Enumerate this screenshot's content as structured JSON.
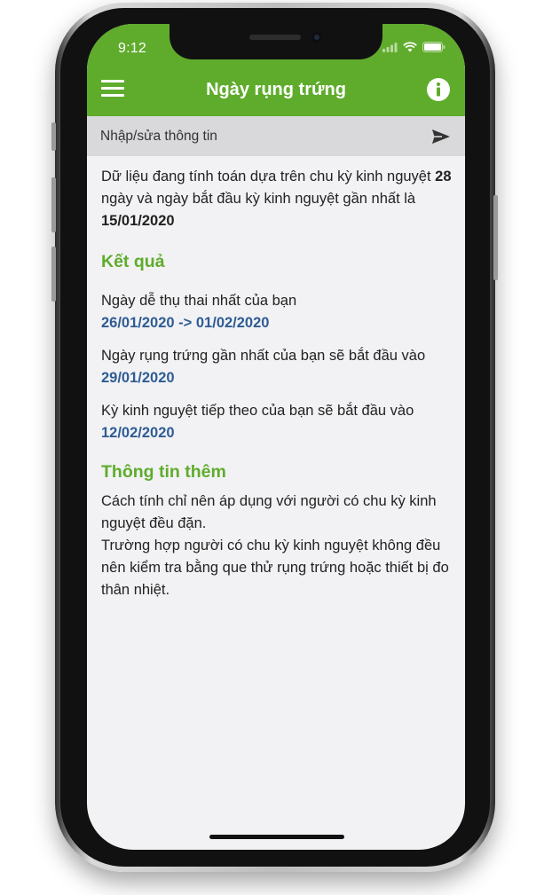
{
  "status_bar": {
    "time": "9:12"
  },
  "nav": {
    "title": "Ngày rụng trứng"
  },
  "input_bar": {
    "label": "Nhập/sửa thông tin"
  },
  "intro": {
    "text_before_cycle": "Dữ liệu đang tính toán dựa trên chu kỳ kinh nguyệt",
    "cycle_days": "28",
    "text_after_cycle": "ngày và ngày bắt đầu kỳ kinh nguyệt gần nhất là",
    "last_period_date": "15/01/2020"
  },
  "results": {
    "heading": "Kết quả",
    "items": [
      {
        "label": "Ngày dễ thụ thai nhất của bạn",
        "value": "26/01/2020 -> 01/02/2020"
      },
      {
        "label": "Ngày rụng trứng gần nhất của bạn sẽ bắt đầu vào",
        "value": "29/01/2020"
      },
      {
        "label": "Kỳ kinh nguyệt tiếp theo của bạn sẽ bắt đầu vào",
        "value": "12/02/2020"
      }
    ]
  },
  "more_info": {
    "heading": "Thông tin thêm",
    "line_1": "Cách tính chỉ nên áp dụng với người có chu kỳ kinh nguyệt đều đặn.",
    "line_2": "Trường hợp người có chu kỳ kinh nguyệt không đều nên kiểm tra bằng que thử rụng trứng hoặc thiết bị đo thân nhiệt."
  },
  "colors": {
    "brand_green": "#5fac2c",
    "date_blue": "#2e5c94",
    "screen_bg": "#f2f2f4"
  },
  "icons": {
    "menu": "hamburger-menu-icon",
    "info": "info-icon",
    "send": "send-icon"
  }
}
